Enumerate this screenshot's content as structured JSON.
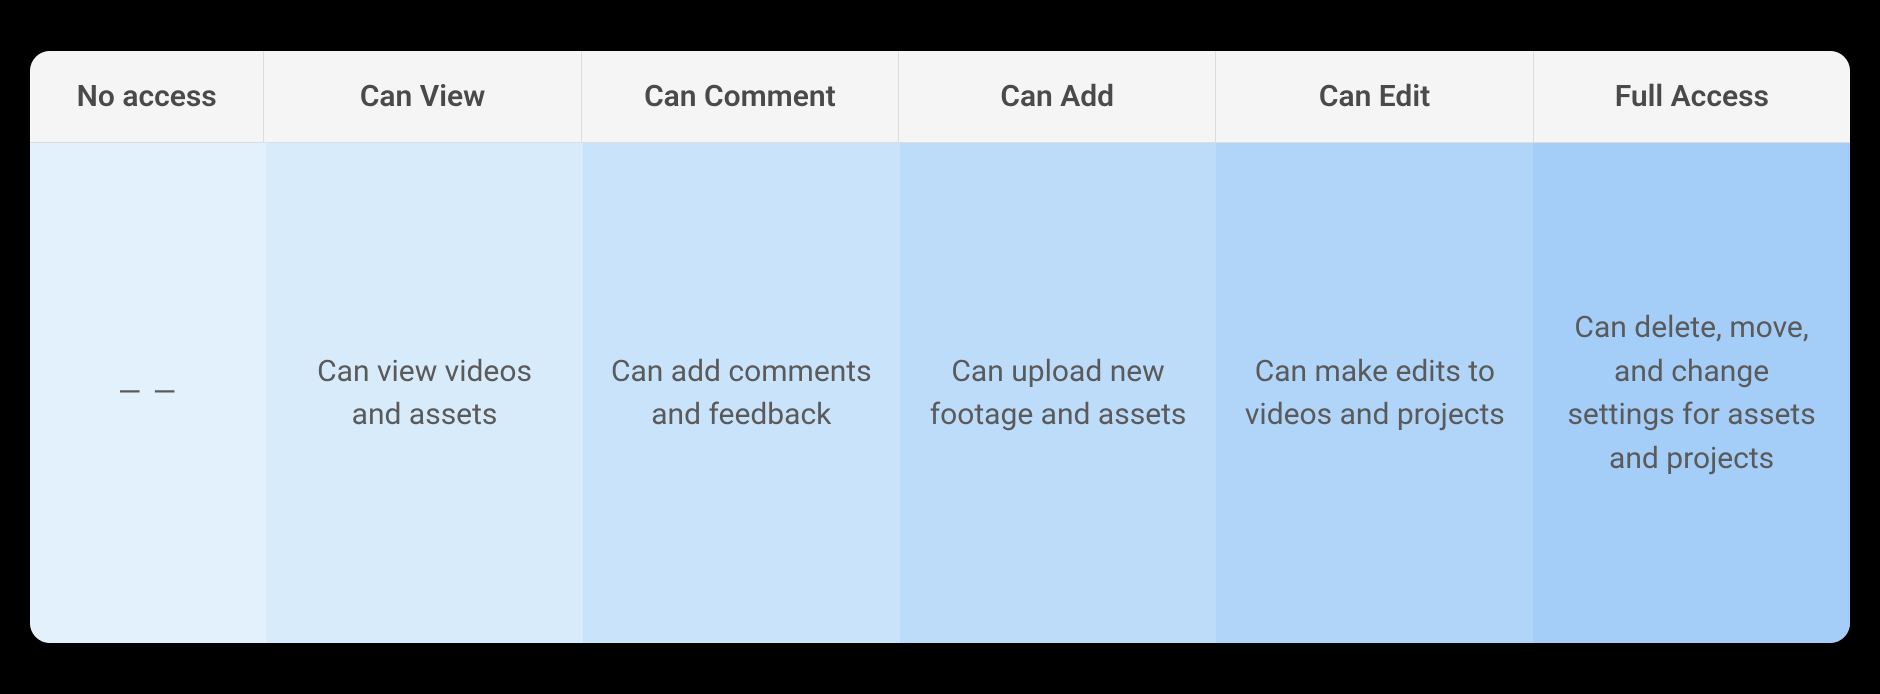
{
  "columns": [
    {
      "header": "No access",
      "desc": "— —"
    },
    {
      "header": "Can View",
      "desc": "Can view videos and assets"
    },
    {
      "header": "Can Comment",
      "desc": "Can add comments and feedback"
    },
    {
      "header": "Can Add",
      "desc": "Can upload new footage and assets"
    },
    {
      "header": "Can Edit",
      "desc": "Can make edits to videos and projects"
    },
    {
      "header": "Full Access",
      "desc": "Can delete, move, and change settings for assets and projects"
    }
  ],
  "colors": {
    "header_bg": "#f5f5f5",
    "cells": [
      "#e3f1fc",
      "#d7ebfb",
      "#c9e3fa",
      "#bcdcf9",
      "#b0d5f8",
      "#a4cef7"
    ]
  }
}
